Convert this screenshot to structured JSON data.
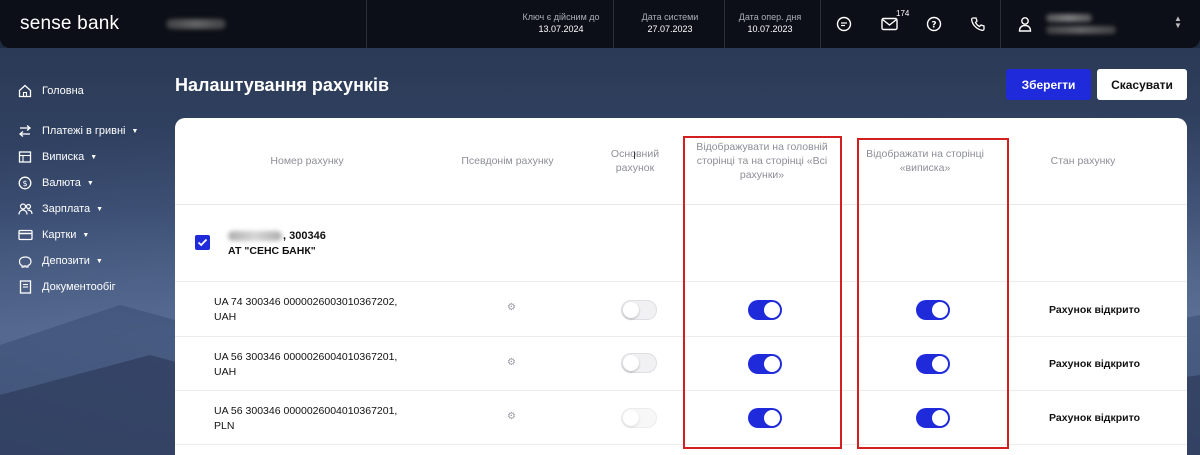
{
  "brand": {
    "logo": "sense bank"
  },
  "topbar": {
    "key_valid_label": "Ключ є дійсним до",
    "key_valid_value": "13.07.2024",
    "system_date_label": "Дата системи",
    "system_date_value": "27.07.2023",
    "oper_day_label": "Дата опер. дня",
    "oper_day_value": "10.07.2023",
    "mail_count": "174",
    "icons": [
      "chat-icon",
      "mail-icon",
      "help-icon",
      "phone-icon",
      "user-icon"
    ]
  },
  "sidebar": {
    "items": [
      {
        "label": "Головна",
        "icon": "home-icon",
        "dropdown": false
      },
      {
        "label": "Платежі в гривні",
        "icon": "transfer-icon",
        "dropdown": true
      },
      {
        "label": "Виписка",
        "icon": "statement-icon",
        "dropdown": true
      },
      {
        "label": "Валюта",
        "icon": "currency-icon",
        "dropdown": true
      },
      {
        "label": "Зарплата",
        "icon": "people-icon",
        "dropdown": true
      },
      {
        "label": "Картки",
        "icon": "card-icon",
        "dropdown": true
      },
      {
        "label": "Депозити",
        "icon": "piggybank-icon",
        "dropdown": true
      },
      {
        "label": "Документообіг",
        "icon": "document-icon",
        "dropdown": false
      }
    ]
  },
  "page": {
    "title": "Налаштування рахунків",
    "save_label": "Зберегти",
    "cancel_label": "Скасувати"
  },
  "table": {
    "headers": {
      "account_number": "Номер рахунку",
      "alias": "Псевдонім рахунку",
      "main_account": "Основний рахунок",
      "show_main": "Відображувати на головній сторінці та на сторінці «Всі рахунки»",
      "show_statement": "Відображати на сторінці «виписка»",
      "status": "Стан рахунку"
    },
    "group": {
      "checked": true,
      "account_suffix": ", 300346",
      "bank": "АТ \"СЕНС БАНК\""
    },
    "rows": [
      {
        "iban": "UA 74 300346 0000026003010367202,",
        "currency": "UAH",
        "main": false,
        "show_main": true,
        "show_statement": true,
        "status": "Рахунок відкрито"
      },
      {
        "iban": "UA 56 300346 0000026004010367201,",
        "currency": "UAH",
        "main": false,
        "show_main": true,
        "show_statement": true,
        "status": "Рахунок відкрито"
      },
      {
        "iban": "UA 56 300346 0000026004010367201,",
        "currency": "PLN",
        "main": false,
        "show_main": true,
        "show_statement": true,
        "status": "Рахунок відкрито"
      }
    ]
  },
  "colors": {
    "accent": "#1f2bdb",
    "highlight": "#d31f1f",
    "topbar": "#0c0f17"
  }
}
